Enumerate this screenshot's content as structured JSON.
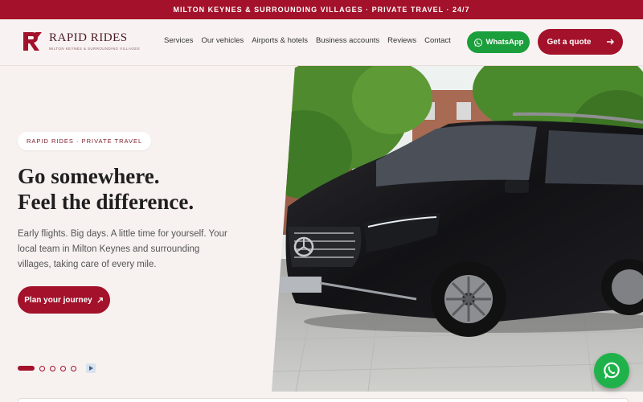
{
  "topbar": {
    "text": "MILTON KEYNES & SURROUNDING VILLAGES · PRIVATE TRAVEL · 24/7"
  },
  "brand": {
    "name": "RAPID RIDES",
    "tagline": "MILTON KEYNES & SURROUNDING VILLAGES"
  },
  "nav": {
    "items": [
      "Services",
      "Our vehicles",
      "Airports & hotels",
      "Business accounts",
      "Reviews",
      "Contact"
    ]
  },
  "header_actions": {
    "whatsapp_label": "WhatsApp",
    "quote_label": "Get a quote"
  },
  "hero": {
    "pill": "RAPID RIDES · PRIVATE TRAVEL",
    "headline_line1": "Go somewhere.",
    "headline_line2": "Feel the difference.",
    "lede": "Early flights. Big days. A little time for yourself. Your local team in Milton Keynes and surrounding villages, taking care of every mile.",
    "cta_label": "Plan your journey"
  },
  "carousel": {
    "slide_count": 5,
    "active_index": 0
  },
  "colors": {
    "brand": "#a3112a",
    "whatsapp": "#1a9f3c",
    "background": "#f7f1f0"
  },
  "icons": [
    "whatsapp-icon",
    "arrow-right-icon",
    "arrow-up-right-icon",
    "play-icon"
  ]
}
